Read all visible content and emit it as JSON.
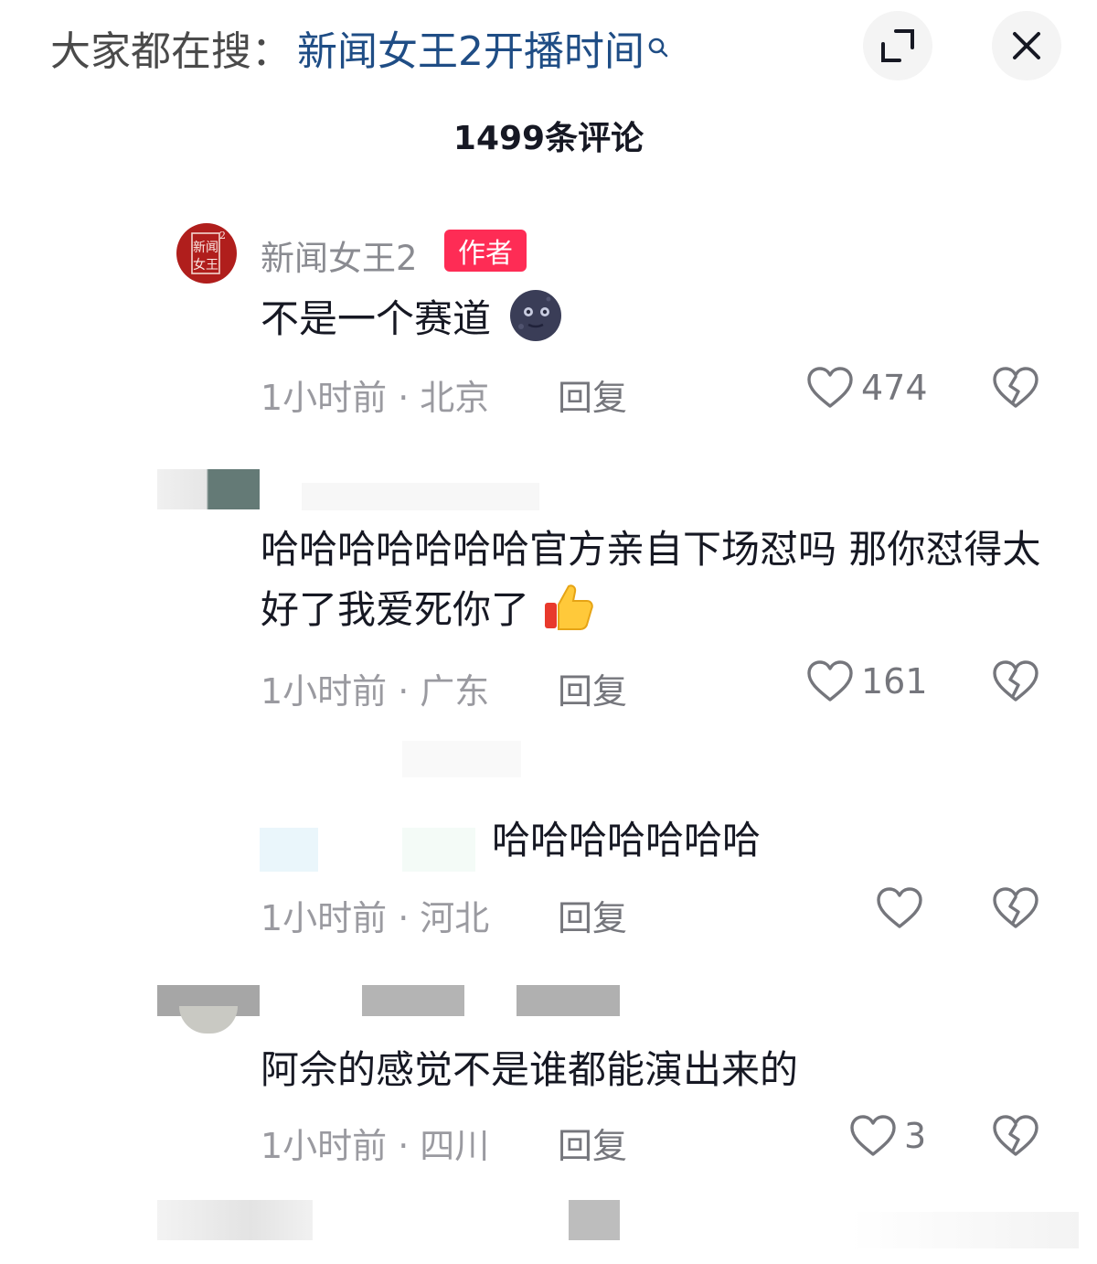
{
  "search": {
    "prefix": "大家都在搜：",
    "query": "新闻女王2开播时间"
  },
  "icons": {
    "search": "search-icon",
    "expand": "expand-icon",
    "close": "close-icon",
    "like": "heart-icon",
    "dislike": "broken-heart-icon"
  },
  "header": {
    "comment_count": "1499条评论"
  },
  "comments": [
    {
      "username": "新闻女王2",
      "badge": "作者",
      "avatar_text": "新闻女王2",
      "text": "不是一个赛道",
      "emoji": "moon-face",
      "time": "1小时前",
      "location": "北京",
      "reply": "回复",
      "likes": "474"
    },
    {
      "text": "哈哈哈哈哈哈哈官方亲自下场怼吗 那你怼得太好了我爱死你了",
      "emoji": "thumbs-up",
      "time": "1小时前",
      "location": "广东",
      "reply": "回复",
      "likes": "161"
    },
    {
      "text": "哈哈哈哈哈哈哈",
      "time": "1小时前",
      "location": "河北",
      "reply": "回复",
      "likes": ""
    },
    {
      "text": "阿佘的感觉不是谁都能演出来的",
      "time": "1小时前",
      "location": "四川",
      "reply": "回复",
      "likes": "3"
    }
  ],
  "colors": {
    "accent_red": "#fe2c55",
    "link_blue": "#1f4d85",
    "brand_avatar": "#b01e1c"
  }
}
